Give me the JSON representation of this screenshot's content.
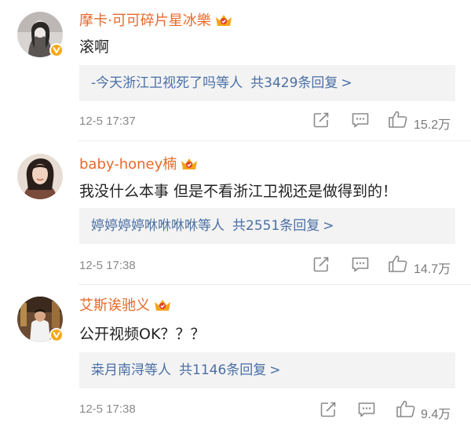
{
  "comments": [
    {
      "username": "摩卡·可可碎片星冰樂",
      "text": "滚啊",
      "reply_prefix": "-",
      "reply_users": "今天浙江卫视死了吗等人",
      "reply_count": "共3429条回复",
      "reply_chevron": ">",
      "timestamp": "12-5 17:37",
      "likes": "15.2万"
    },
    {
      "username": "baby-honey楠",
      "text": "我没什么本事 但是不看浙江卫视还是做得到的！",
      "reply_prefix": "",
      "reply_users": "婷婷婷婷咻咻咻咻等人",
      "reply_count": "共2551条回复",
      "reply_chevron": ">",
      "timestamp": "12-5 17:38",
      "likes": "14.7万"
    },
    {
      "username": "艾斯诶驰义",
      "text": "公开视频OK？？？",
      "reply_prefix": "",
      "reply_users": "桒月南浔等人",
      "reply_count": "共1146条回复",
      "reply_chevron": ">",
      "timestamp": "12-5 17:38",
      "likes": "9.4万"
    }
  ],
  "icons": {
    "share": "share-icon",
    "comment": "comment-icon",
    "like": "thumbs-up-icon",
    "crown": "crown-badge-icon",
    "verified": "verified-v-icon"
  },
  "colors": {
    "username": "#e86a2b",
    "link": "#4a6fa5",
    "reply_bg": "#f3f3f3",
    "meta": "#8a8a8a",
    "badge": "#f7a817"
  }
}
